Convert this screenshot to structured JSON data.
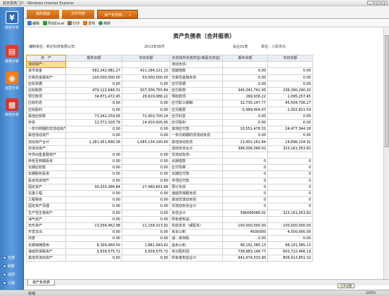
{
  "window": {
    "title": "财务报表门户 - Windows Internet Explorer"
  },
  "sidebar": {
    "items": [
      {
        "label": "财务分析",
        "icon": "yen-icon",
        "glyph": "¥"
      },
      {
        "label": "报表分析",
        "icon": "chart-icon",
        "glyph": "▤"
      },
      {
        "label": "运营分析",
        "icon": "ops-icon",
        "glyph": "◉"
      },
      {
        "label": "库存分析",
        "icon": "stock-icon",
        "glyph": "▦"
      }
    ],
    "bottom": [
      "全部",
      "刷新",
      "选项",
      "注销"
    ]
  },
  "tabs": [
    {
      "label": "我的桌面"
    },
    {
      "label": "文件列表"
    },
    {
      "label": "资产负债表(..."
    }
  ],
  "toolbar": {
    "buttons": [
      "编辑",
      "导出Excel",
      "打印",
      "发布",
      "刷新"
    ]
  },
  "report": {
    "title": "资产负债表（合并报表）",
    "company": "编制单位：新达科技有限公司",
    "period": "2013年08月",
    "form": "会企01表",
    "unit": "单位：人民币元",
    "headers": [
      "资　产",
      "期末余额",
      "年初余额",
      "负债和所有者权益(或股东权益)",
      "期末余额",
      "年初余额"
    ],
    "rows": [
      [
        "流动资产：",
        "",
        "",
        "流动负债：",
        "",
        ""
      ],
      [
        "货币资金",
        "582,242,981.27",
        "411,184,221.15",
        "短期借款",
        "0.00",
        "0.00"
      ],
      [
        "交易性金融资产",
        "100,000,000.00",
        "50,000,000.00",
        "交易性金融负债",
        "0.00",
        "0.00"
      ],
      [
        "应收票据",
        "0.00",
        "0.00",
        "应付票据",
        "0.00",
        "0.00"
      ],
      [
        "应收账款",
        "479,122,648.31",
        "507,306,755.84",
        "应付账款",
        "345,041,741.95",
        "238,390,290.20"
      ],
      [
        "预付款项",
        "34,871,472.45",
        "28,629,086.22",
        "预收款项",
        "269,938.22",
        "1,095,257.45"
      ],
      [
        "应收利息",
        "0.00",
        "0.00",
        "应付职工薪酬",
        "32,730,147.77",
        "45,504,736.27"
      ],
      [
        "应收股利",
        "0.00",
        "0.00",
        "应交税费",
        "-5,989,404.07",
        "-1,002,811.59"
      ],
      [
        "其他应收款",
        "73,342,259.56",
        "72,903,700.24",
        "应付利息",
        "0.00",
        "0.00"
      ],
      [
        "存货",
        "12,372,328.79",
        "14,910,426.95",
        "应付股利",
        "0.00",
        "0.00"
      ],
      [
        "一年内到期的非流动资产",
        "0.00",
        "0.00",
        "其他应付款",
        "10,551,476.31",
        "24,477,344.18"
      ],
      [
        "其他流动资产",
        "0.00",
        "0.00",
        "一年内到期的非流动负债",
        "0.00",
        "0.00"
      ],
      [
        "流动资产合计",
        "1,281,951,690.38",
        "1,085,134,190.40",
        "其他流动负债",
        "13,402,162.84",
        "14,696,234.31"
      ],
      [
        "非流动资产：",
        "",
        "",
        "流动负债合计",
        "396,006,066.02",
        "323,161,053.82"
      ],
      [
        "可供出售金融资产",
        "0.00",
        "0.00",
        "非流动负债：",
        "",
        ""
      ],
      [
        "持有至到期投资",
        "0.00",
        "0.00",
        "长期借款",
        "0",
        "0"
      ],
      [
        "长期应收款",
        "0.00",
        "0.00",
        "应付债券",
        "0",
        "0"
      ],
      [
        "长期股权投资",
        "0.00",
        "0.00",
        "长期应付款",
        "0",
        "0"
      ],
      [
        "投资性房地产",
        "0.00",
        "0.00",
        "专项应付款",
        "0",
        "0"
      ],
      [
        "固定资产",
        "30,333,386.84",
        "27,460,831.68",
        "预计负债",
        "0",
        "0"
      ],
      [
        "在建工程",
        "0.00",
        "0.00",
        "递延所得税负债",
        "0",
        "0"
      ],
      [
        "工程物资",
        "0.00",
        "0.00",
        "其他非流动负债",
        "0",
        "0"
      ],
      [
        "固定资产清理",
        "0.00",
        "0.00",
        "非流动负债合计",
        "0",
        "0"
      ],
      [
        "生产性生物资产",
        "0.00",
        "0.00",
        "负债合计",
        "396006066.02",
        "323,161,053.82"
      ],
      [
        "油气资产",
        "0.00",
        "0.00",
        "所有者权益：",
        "",
        ""
      ],
      [
        "无形资产",
        "13,056,462.98",
        "11,158,313.92",
        "实收资本（或股本）",
        "100,000,000.00",
        "100,000,000.00"
      ],
      [
        "开发支出",
        "0.00",
        "0.00",
        "资本公积",
        "4500000",
        "4,500,000.00"
      ],
      [
        "商誉",
        "0.00",
        "0.00",
        "减：库存股",
        "0.00",
        "0.00"
      ],
      [
        "长期待摊费用",
        "8,399,484.00",
        "1,881,993.42",
        "盈余公积",
        "98,191,385.13",
        "98,191,385.13"
      ],
      [
        "递延所得税资产",
        "3,939,575.72",
        "3,939,575.72",
        "未分配利润",
        "738,983,148.77",
        "603,722,466.19"
      ],
      [
        "其他非流动资产",
        "0.00",
        "0.00",
        "所有者权益合计",
        "941,674,533.90",
        "806,413,851.32"
      ]
    ]
  },
  "sheet_tab": "资产负债表",
  "status": {
    "left": "就绪",
    "right_zoom": "100%"
  },
  "tooltip": "打开设置"
}
